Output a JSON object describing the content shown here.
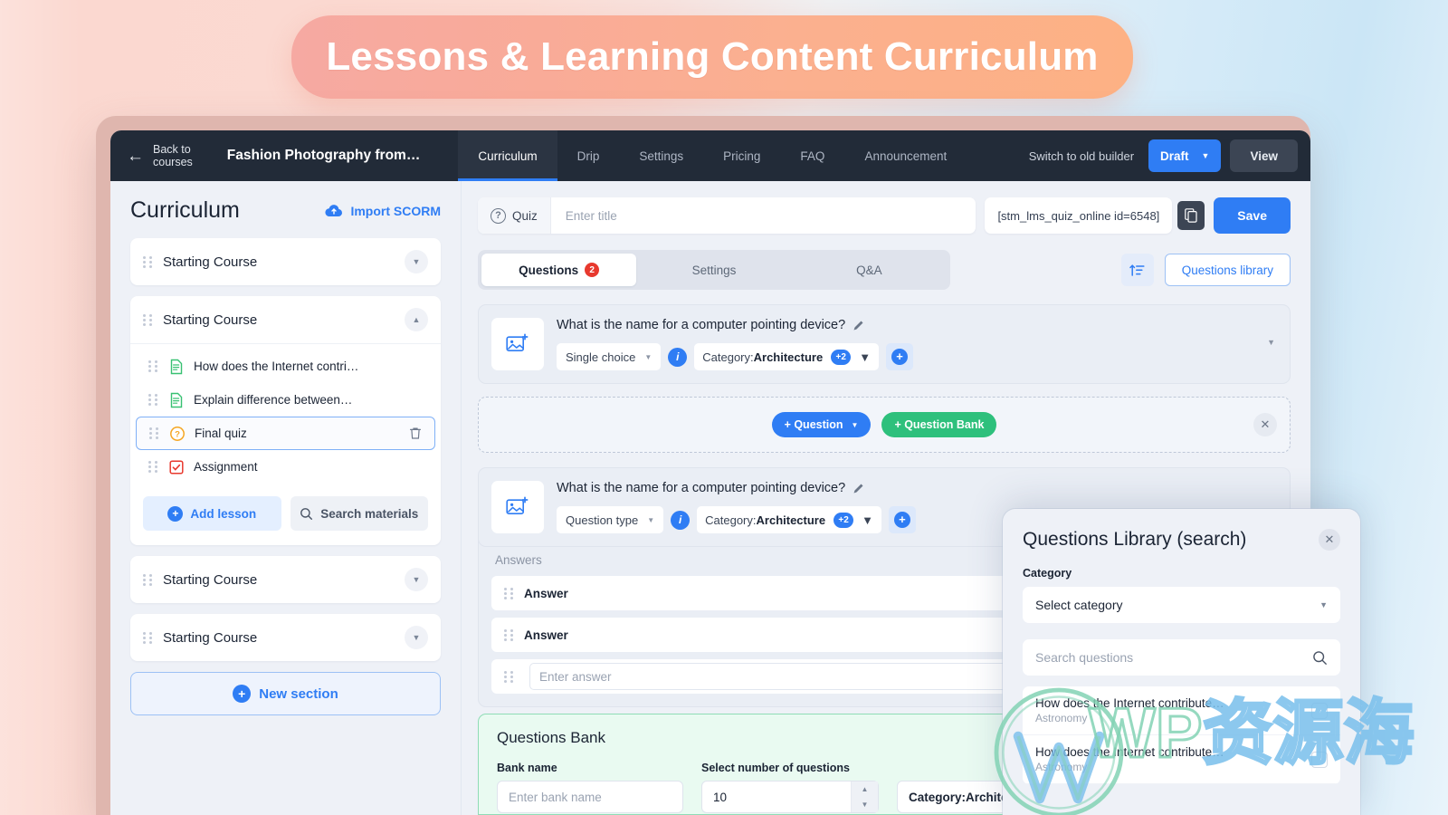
{
  "banner": {
    "title": "Lessons & Learning Content Curriculum"
  },
  "topnav": {
    "back_label_line1": "Back to",
    "back_label_line2": "courses",
    "back_icon": "arrow-left-icon",
    "course_title": "Fashion Photography from…",
    "tabs": [
      {
        "label": "Curriculum",
        "active": true
      },
      {
        "label": "Drip",
        "active": false
      },
      {
        "label": "Settings",
        "active": false
      },
      {
        "label": "Pricing",
        "active": false
      },
      {
        "label": "FAQ",
        "active": false
      },
      {
        "label": "Announcement",
        "active": false
      }
    ],
    "switch_label": "Switch to old builder",
    "draft_label": "Draft",
    "view_label": "View",
    "accent_blue": "#2f7df4",
    "bar_color": "#222b38"
  },
  "sidebar": {
    "title": "Curriculum",
    "import_scorm": "Import SCORM",
    "import_icon": "cloud-upload-icon",
    "sections": [
      {
        "name": "Starting Course",
        "expanded": false
      },
      {
        "name": "Starting Course",
        "expanded": true
      },
      {
        "name": "Starting Course",
        "expanded": false
      },
      {
        "name": "Starting Course",
        "expanded": false
      }
    ],
    "lessons": [
      {
        "name": "How does the Internet contri…",
        "icon": "document-green-icon",
        "selected": false
      },
      {
        "name": "Explain difference between…",
        "icon": "document-green-icon",
        "selected": false
      },
      {
        "name": "Final quiz",
        "icon": "question-orange-icon",
        "selected": true
      },
      {
        "name": "Assignment",
        "icon": "checklist-red-icon",
        "selected": false
      }
    ],
    "add_lesson": "Add lesson",
    "search_materials": "Search materials",
    "search_icon": "search-icon",
    "new_section": "New section",
    "delete_icon": "trash-icon"
  },
  "quiz_header": {
    "type_label": "Quiz",
    "type_icon": "question-circle-icon",
    "title_placeholder": "Enter title",
    "title_value": "",
    "shortcode": "[stm_lms_quiz_online id=6548]",
    "copy_icon": "copy-icon",
    "save_label": "Save"
  },
  "content_tabs": {
    "items": [
      {
        "label": "Questions",
        "badge": "2",
        "active": true
      },
      {
        "label": "Settings",
        "badge": "",
        "active": false
      },
      {
        "label": "Q&A",
        "badge": "",
        "active": false
      }
    ],
    "sort_icon": "sort-ascending-icon",
    "questions_library": "Questions library"
  },
  "questions": [
    {
      "text": "What is the name for a computer pointing device?",
      "edit_icon": "pencil-icon",
      "thumb_icon": "image-add-icon",
      "type_label": "Single choice",
      "info_icon": "info-icon",
      "category_prefix": "Category:",
      "category_value": "Architecture",
      "extra_count": "+2",
      "add_icon": "plus-icon",
      "collapse_icon": "chevron-down-icon"
    },
    {
      "text": "What is the name for a computer pointing device?",
      "edit_icon": "pencil-icon",
      "thumb_icon": "image-add-icon",
      "type_label": "Question type",
      "info_icon": "info-icon",
      "category_prefix": "Category:",
      "category_value": "Architecture",
      "extra_count": "+2",
      "add_icon": "plus-icon",
      "collapse_icon": "chevron-down-icon"
    }
  ],
  "dropzone": {
    "add_question": "+ Question",
    "add_question_bank": "+ Question Bank",
    "close_icon": "close-icon",
    "question_color": "#2f7df4",
    "bank_color": "#2ec07c"
  },
  "answers": {
    "label": "Answers",
    "rows": [
      "Answer",
      "Answer"
    ],
    "input_placeholder": "Enter answer",
    "input_value": ""
  },
  "questions_bank": {
    "title": "Questions Bank",
    "bank_name_label": "Bank name",
    "bank_name_placeholder": "Enter bank name",
    "bank_name_value": "",
    "number_label": "Select number of questions",
    "number_value": "10",
    "category_text": "Category:Architec:",
    "panel_color": "#e9faf1",
    "border_color": "#8fdcb6"
  },
  "questions_library": {
    "title": "Questions Library (search)",
    "close_icon": "close-icon",
    "category_label": "Category",
    "category_placeholder": "Select category",
    "search_placeholder": "Search questions",
    "search_value": "",
    "search_icon": "search-icon",
    "items": [
      {
        "title": "How does the Internet contribute…",
        "category": "Astronomy"
      },
      {
        "title": "How does the Internet contribute…",
        "category": "Astronomy"
      }
    ]
  },
  "watermark": {
    "text_wp": "WP",
    "text_cn": "资源海",
    "logo": "wordpress-logo-icon"
  }
}
